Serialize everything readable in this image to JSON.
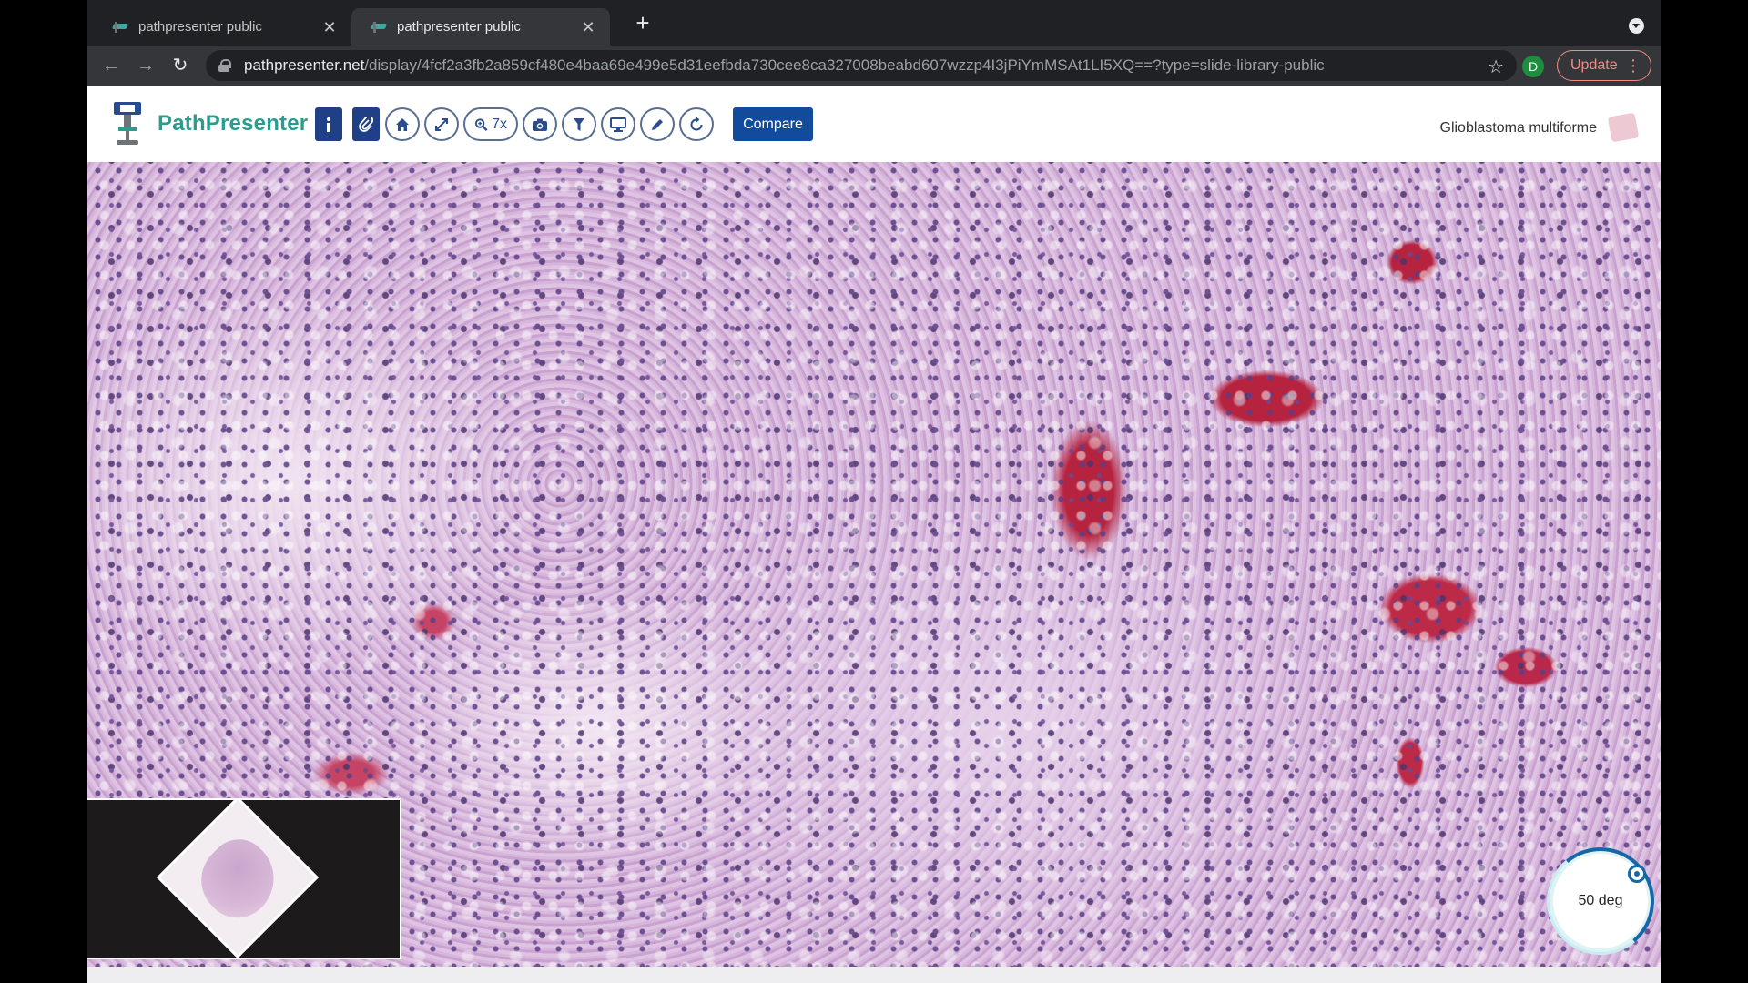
{
  "browser": {
    "tabs": [
      {
        "title": "pathpresenter public",
        "active": false
      },
      {
        "title": "pathpresenter public",
        "active": true
      }
    ],
    "url_host": "pathpresenter.net",
    "url_path": "/display/4fcf2a3fb2a859cf480e4baa69e499e5d31eefbda730cee8ca327008beabd607wzzp4I3jPiYmMSAt1LI5XQ==?type=slide-library-public",
    "profile_initial": "D",
    "update_label": "Update",
    "icons": {
      "back": "back-arrow-icon",
      "forward": "forward-arrow-icon",
      "reload": "reload-icon",
      "star": "bookmark-star-icon"
    }
  },
  "app": {
    "brand": "PathPresenter",
    "zoom_label": "7x",
    "compare_label": "Compare",
    "slide_title": "Glioblastoma multiforme",
    "tools": [
      "info-icon",
      "paperclip-icon",
      "home-icon",
      "expand-icon",
      "zoom-icon",
      "camera-icon",
      "filter-icon",
      "monitor-icon",
      "pencil-icon",
      "rotate-icon"
    ]
  },
  "viewer": {
    "rotation_label": "50 deg",
    "rotation_degrees": 50
  },
  "colors": {
    "brand": "#2b9c8e",
    "compare_button": "#134b9c",
    "dial_accent": "#1567a5",
    "update_accent": "#f28b82"
  }
}
